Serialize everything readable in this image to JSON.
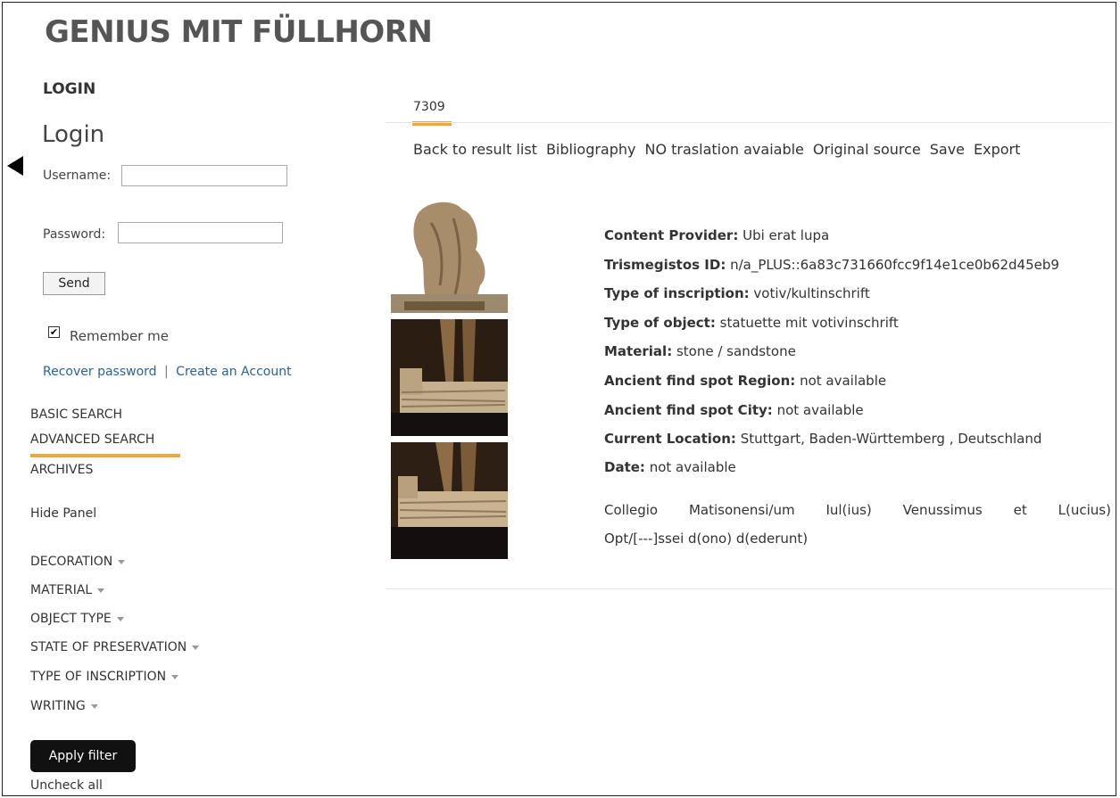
{
  "title": "GENIUS MIT FÜLLHORN",
  "sidebar": {
    "login_heading": "LOGIN",
    "login_title": "Login",
    "username_label": "Username:",
    "password_label": "Password:",
    "send_label": "Send",
    "remember_label": "Remember me",
    "remember_checked": true,
    "recover_label": "Recover password",
    "separator": "|",
    "create_label": "Create an Account",
    "nav": [
      "BASIC SEARCH",
      "ADVANCED SEARCH",
      "ARCHIVES"
    ],
    "active_nav": "ADVANCED SEARCH",
    "hide_panel": "Hide Panel",
    "facets": [
      "DECORATION",
      "MATERIAL",
      "OBJECT TYPE",
      "STATE OF PRESERVATION",
      "TYPE OF INSCRIPTION",
      "WRITING"
    ],
    "apply_label": "Apply filter",
    "uncheck_label": "Uncheck all"
  },
  "record": {
    "tab": "7309",
    "actions": [
      "Back to result list",
      "Bibliography",
      "NO traslation avaiable",
      "Original source",
      "Save",
      "Export"
    ],
    "fields": [
      {
        "label": "Content Provider:",
        "value": "Ubi erat lupa"
      },
      {
        "label": "Trismegistos ID:",
        "value": "n/a_PLUS::6a83c731660fcc9f14e1ce0b62d45eb9"
      },
      {
        "label": "Type of inscription:",
        "value": "votiv/kultinschrift"
      },
      {
        "label": "Type of object:",
        "value": "statuette mit votivinschrift"
      },
      {
        "label": "Material:",
        "value": "stone / sandstone"
      },
      {
        "label": "Ancient find spot Region:",
        "value": "not available"
      },
      {
        "label": "Ancient find spot City:",
        "value": "not available"
      },
      {
        "label": "Current Location:",
        "value": "Stuttgart, Baden-Württemberg , Deutschland"
      },
      {
        "label": "Date:",
        "value": "not available"
      }
    ],
    "inscription_line1": [
      "Collegio",
      "Matisonensi/um",
      "Iul(ius)",
      "Venussimus",
      "et",
      "L(ucius)"
    ],
    "inscription_line2": "Opt/[---]ssei d(ono) d(ederunt)"
  },
  "colors": {
    "accent": "#f0a83c",
    "link": "#2a6496",
    "button_dark": "#111111"
  }
}
